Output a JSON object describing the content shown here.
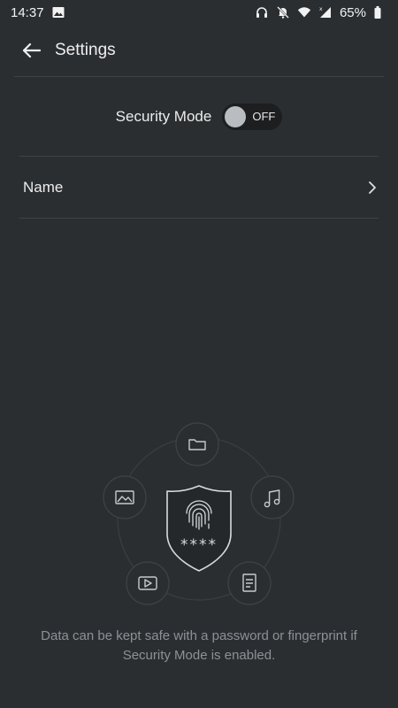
{
  "status_bar": {
    "time": "14:37",
    "battery": "65%",
    "icons_left": [
      "image-icon"
    ],
    "icons_right": [
      "headset-icon",
      "bell-off-icon",
      "wifi-icon",
      "signal-icon",
      "battery-icon"
    ]
  },
  "header": {
    "back_icon": "arrow-left-icon",
    "title": "Settings"
  },
  "security": {
    "label": "Security Mode",
    "toggle_state": "OFF"
  },
  "name_row": {
    "label": "Name",
    "chevron_icon": "chevron-right-icon"
  },
  "illustration": {
    "center_icon": "fingerprint-shield-icon",
    "center_text": "****",
    "orbit_icons": [
      "folder-icon",
      "music-icon",
      "document-icon",
      "video-icon",
      "image-icon"
    ]
  },
  "footer": {
    "caption": "Data can be kept safe with a password or fingerprint if Security Mode is enabled."
  },
  "colors": {
    "background": "#2b2e31",
    "divider": "#3e4246",
    "caption": "#8d9196",
    "toggle_track": "#1c1e20",
    "toggle_knob": "#b9bcc0"
  }
}
